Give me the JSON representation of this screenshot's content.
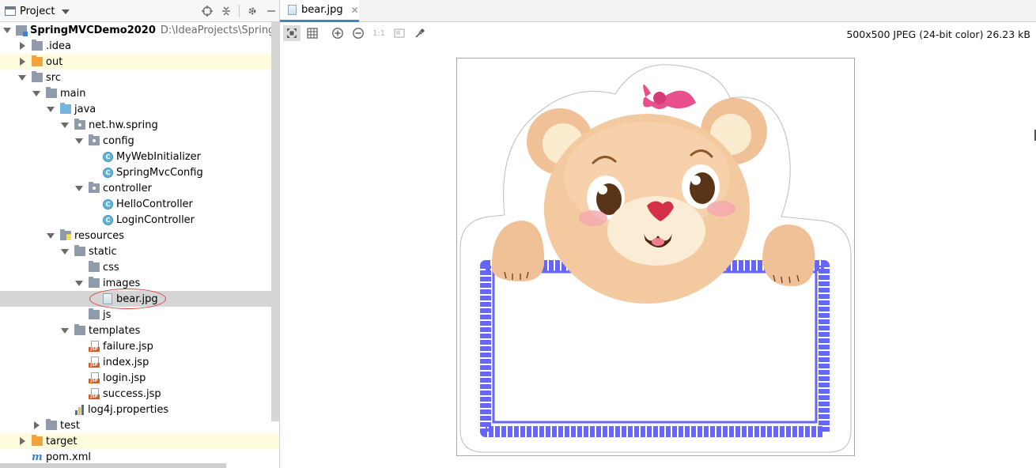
{
  "panel": {
    "title": "Project",
    "tools": [
      "locate-icon",
      "collapse-icon",
      "gear-icon",
      "minimize-icon"
    ]
  },
  "tree": [
    {
      "label": "SpringMVCDemo2020",
      "path": "D:\\IdeaProjects\\SpringMVCDe",
      "icon": "module-icon",
      "arrow": "down",
      "level": 0,
      "bold": true
    },
    {
      "label": ".idea",
      "icon": "folder-icon",
      "arrow": "right",
      "level": 1
    },
    {
      "label": "out",
      "icon": "folder-orange-icon",
      "arrow": "right",
      "level": 1,
      "highlight": "yellow"
    },
    {
      "label": "src",
      "icon": "folder-icon",
      "arrow": "down",
      "level": 1
    },
    {
      "label": "main",
      "icon": "folder-icon",
      "arrow": "down",
      "level": 2
    },
    {
      "label": "java",
      "icon": "source-folder-icon",
      "arrow": "down",
      "level": 3
    },
    {
      "label": "net.hw.spring",
      "icon": "package-icon",
      "arrow": "down",
      "level": 4
    },
    {
      "label": "config",
      "icon": "package-icon",
      "arrow": "down",
      "level": 5
    },
    {
      "label": "MyWebInitializer",
      "icon": "class-icon",
      "arrow": "none",
      "level": 6
    },
    {
      "label": "SpringMvcConfig",
      "icon": "class-icon",
      "arrow": "none",
      "level": 6
    },
    {
      "label": "controller",
      "icon": "package-icon",
      "arrow": "down",
      "level": 5
    },
    {
      "label": "HelloController",
      "icon": "class-icon",
      "arrow": "none",
      "level": 6
    },
    {
      "label": "LoginController",
      "icon": "class-icon",
      "arrow": "none",
      "level": 6
    },
    {
      "label": "resources",
      "icon": "resources-folder-icon",
      "arrow": "down",
      "level": 3
    },
    {
      "label": "static",
      "icon": "folder-icon",
      "arrow": "down",
      "level": 4
    },
    {
      "label": "css",
      "icon": "folder-icon",
      "arrow": "none",
      "level": 5
    },
    {
      "label": "images",
      "icon": "folder-icon",
      "arrow": "down",
      "level": 5
    },
    {
      "label": "bear.jpg",
      "icon": "image-file-icon",
      "arrow": "none",
      "level": 6,
      "selected": true
    },
    {
      "label": "js",
      "icon": "folder-icon",
      "arrow": "none",
      "level": 5
    },
    {
      "label": "templates",
      "icon": "folder-icon",
      "arrow": "down",
      "level": 4
    },
    {
      "label": "failure.jsp",
      "icon": "jsp-icon",
      "arrow": "none",
      "level": 5
    },
    {
      "label": "index.jsp",
      "icon": "jsp-icon",
      "arrow": "none",
      "level": 5
    },
    {
      "label": "login.jsp",
      "icon": "jsp-icon",
      "arrow": "none",
      "level": 5
    },
    {
      "label": "success.jsp",
      "icon": "jsp-icon",
      "arrow": "none",
      "level": 5
    },
    {
      "label": "log4j.properties",
      "icon": "properties-icon",
      "arrow": "none",
      "level": 4
    },
    {
      "label": "test",
      "icon": "folder-icon",
      "arrow": "right",
      "level": 2
    },
    {
      "label": "target",
      "icon": "folder-orange-icon",
      "arrow": "right",
      "level": 1,
      "highlight": "yellow"
    },
    {
      "label": "pom.xml",
      "icon": "maven-icon",
      "arrow": "none",
      "level": 1
    }
  ],
  "editor": {
    "tab_label": "bear.jpg",
    "image_info": "500x500 JPEG (24-bit color) 26.23 kB",
    "toolbar": {
      "actual_size_label": "1:1",
      "buttons": [
        "zoom-to-fit-icon",
        "grid-icon",
        "zoom-in-icon",
        "zoom-out-icon",
        "actual-size-icon",
        "background-icon",
        "color-picker-icon"
      ]
    },
    "image": {
      "subject": "bear-holding-sign",
      "frame_color": "#6666ff",
      "bear_color": "#f3c9a0",
      "bow_color": "#e8508c"
    }
  }
}
